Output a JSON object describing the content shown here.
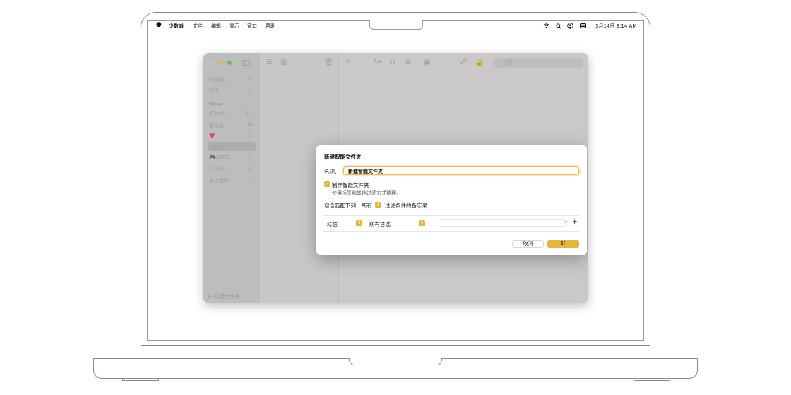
{
  "menubar": {
    "apple": "",
    "app_name": "少数派",
    "items": [
      "文件",
      "编辑",
      "显示",
      "窗口",
      "帮助"
    ],
    "datetime": "3月14日  3:14 AM"
  },
  "window": {
    "sidebar": {
      "items": [
        {
          "label": "快速备...",
          "count": "1"
        },
        {
          "label": "共享",
          "count": "3"
        }
      ],
      "section_header": "iCloud",
      "icloud_items": [
        {
          "label": "iCloud ...",
          "count": "20"
        },
        {
          "label": "备忘录",
          "count": "16"
        },
        {
          "label": "💗",
          "count": "2"
        },
        {
          "label": "少数派",
          "count": "0"
        },
        {
          "label": "🎮GAME",
          "count": "0"
        },
        {
          "label": "公众号...",
          "count": "2"
        },
        {
          "label": "最近删除",
          "count": "2"
        }
      ],
      "new_folder": "新建文件夹"
    },
    "search_placeholder": "搜索"
  },
  "dialog": {
    "title": "新建智能文件夹",
    "name_label": "名称:",
    "name_value": "新建智能文件夹",
    "checkbox_label": "制作智能文件夹",
    "checkbox_desc": "使用标签和其他过滤方式整理。",
    "match_prefix": "包含匹配下列",
    "match_option": "所有",
    "match_suffix": "过滤条件的备忘录:",
    "rule_field": "标签",
    "rule_value": "所有已选",
    "cancel": "取消",
    "ok": "好"
  },
  "colors": {
    "accent": "#e3b73c",
    "traffic_close": "#c0c0c0",
    "traffic_min": "#e8b340",
    "traffic_max": "#5fc24a"
  }
}
